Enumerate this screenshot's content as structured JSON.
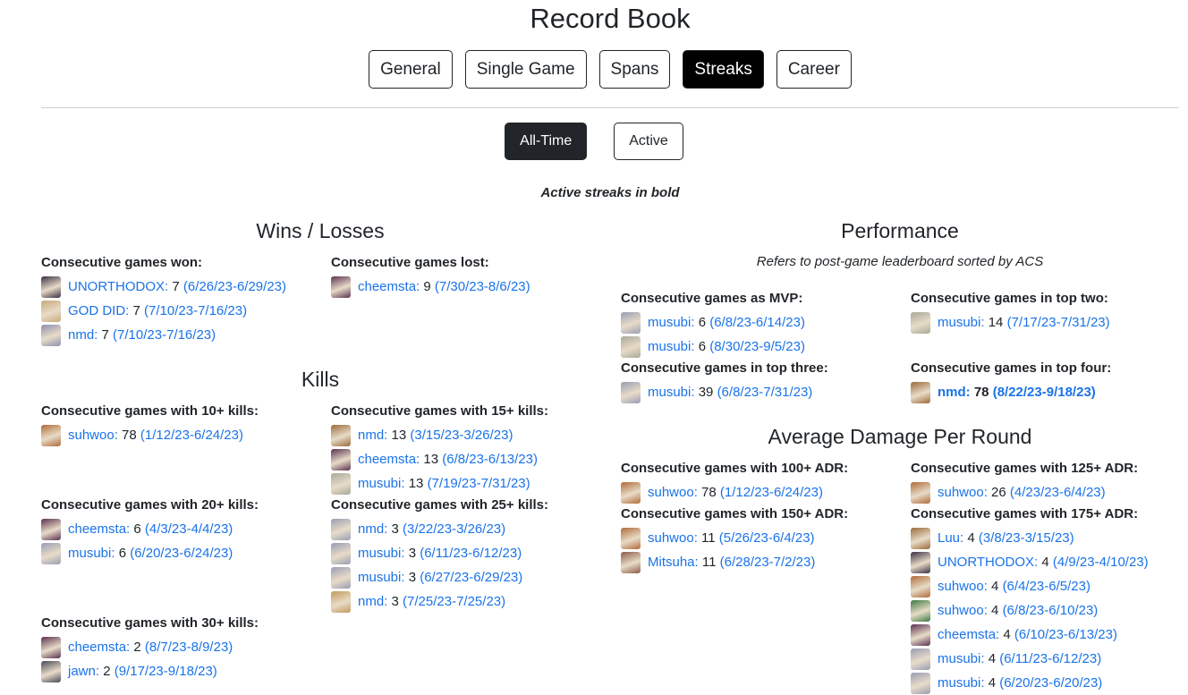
{
  "page_title": "Record Book",
  "tabs": [
    {
      "label": "General",
      "active": false
    },
    {
      "label": "Single Game",
      "active": false
    },
    {
      "label": "Spans",
      "active": false
    },
    {
      "label": "Streaks",
      "active": true
    },
    {
      "label": "Career",
      "active": false
    }
  ],
  "subtabs": [
    {
      "label": "All-Time",
      "active": true
    },
    {
      "label": "Active",
      "active": false
    }
  ],
  "note": "Active streaks in bold",
  "sections": {
    "wins": "Wins / Losses",
    "kills": "Kills",
    "performance": "Performance",
    "performance_note": "Refers to post-game leaderboard sorted by ACS",
    "adr": "Average Damage Per Round"
  },
  "blocks": {
    "games_won": {
      "title": "Consecutive games won:",
      "entries": [
        {
          "player": "UNORTHODOX:",
          "value": "7",
          "dates": "(6/26/23-6/29/23)",
          "avatar": "#3a2f45"
        },
        {
          "player": "GOD DID:",
          "value": "7",
          "dates": "(7/10/23-7/16/23)",
          "avatar": "#c9a878"
        },
        {
          "player": "nmd:",
          "value": "7",
          "dates": "(7/10/23-7/16/23)",
          "avatar": "#8c8fb0"
        }
      ]
    },
    "games_lost": {
      "title": "Consecutive games lost:",
      "entries": [
        {
          "player": "cheemsta:",
          "value": "9",
          "dates": "(7/30/23-8/6/23)",
          "avatar": "#5a3050"
        }
      ]
    },
    "kills10": {
      "title": "Consecutive games with 10+ kills:",
      "entries": [
        {
          "player": "suhwoo:",
          "value": "78",
          "dates": "(1/12/23-6/24/23)",
          "avatar": "#b06a38"
        }
      ]
    },
    "kills15": {
      "title": "Consecutive games with 15+ kills:",
      "entries": [
        {
          "player": "nmd:",
          "value": "13",
          "dates": "(3/15/23-3/26/23)",
          "avatar": "#9a6a3a"
        },
        {
          "player": "cheemsta:",
          "value": "13",
          "dates": "(6/8/23-6/13/23)",
          "avatar": "#5a3050"
        },
        {
          "player": "musubi:",
          "value": "13",
          "dates": "(7/19/23-7/31/23)",
          "avatar": "#a8a898"
        }
      ]
    },
    "kills20": {
      "title": "Consecutive games with 20+ kills:",
      "entries": [
        {
          "player": "cheemsta:",
          "value": "6",
          "dates": "(4/3/23-4/4/23)",
          "avatar": "#5a3050"
        },
        {
          "player": "musubi:",
          "value": "6",
          "dates": "(6/20/23-6/24/23)",
          "avatar": "#9a9cb4"
        }
      ]
    },
    "kills25": {
      "title": "Consecutive games with 25+ kills:",
      "entries": [
        {
          "player": "nmd:",
          "value": "3",
          "dates": "(3/22/23-3/26/23)",
          "avatar": "#9a9cb4"
        },
        {
          "player": "musubi:",
          "value": "3",
          "dates": "(6/11/23-6/12/23)",
          "avatar": "#9a9cb4"
        },
        {
          "player": "musubi:",
          "value": "3",
          "dates": "(6/27/23-6/29/23)",
          "avatar": "#9a9cb4"
        },
        {
          "player": "nmd:",
          "value": "3",
          "dates": "(7/25/23-7/25/23)",
          "avatar": "#c29a5a"
        }
      ]
    },
    "kills30": {
      "title": "Consecutive games with 30+ kills:",
      "entries": [
        {
          "player": "cheemsta:",
          "value": "2",
          "dates": "(8/7/23-8/9/23)",
          "avatar": "#5a3050"
        },
        {
          "player": "jawn:",
          "value": "2",
          "dates": "(9/17/23-9/18/23)",
          "avatar": "#4a4a58"
        }
      ]
    },
    "mvp": {
      "title": "Consecutive games as MVP:",
      "entries": [
        {
          "player": "musubi:",
          "value": "6",
          "dates": "(6/8/23-6/14/23)",
          "avatar": "#9a9cb4"
        },
        {
          "player": "musubi:",
          "value": "6",
          "dates": "(8/30/23-9/5/23)",
          "avatar": "#a8a898"
        }
      ]
    },
    "top2": {
      "title": "Consecutive games in top two:",
      "entries": [
        {
          "player": "musubi:",
          "value": "14",
          "dates": "(7/17/23-7/31/23)",
          "avatar": "#a8a898"
        }
      ]
    },
    "top3": {
      "title": "Consecutive games in top three:",
      "entries": [
        {
          "player": "musubi:",
          "value": "39",
          "dates": "(6/8/23-7/31/23)",
          "avatar": "#9a9cb4"
        }
      ]
    },
    "top4": {
      "title": "Consecutive games in top four:",
      "entries": [
        {
          "player": "nmd:",
          "value": "78",
          "dates": "(8/22/23-9/18/23)",
          "avatar": "#9a6a3a",
          "bold": true
        }
      ]
    },
    "adr100": {
      "title": "Consecutive games with 100+ ADR:",
      "entries": [
        {
          "player": "suhwoo:",
          "value": "78",
          "dates": "(1/12/23-6/24/23)",
          "avatar": "#b06a38"
        }
      ]
    },
    "adr125": {
      "title": "Consecutive games with 125+ ADR:",
      "entries": [
        {
          "player": "suhwoo:",
          "value": "26",
          "dates": "(4/23/23-6/4/23)",
          "avatar": "#b06a38"
        }
      ]
    },
    "adr150": {
      "title": "Consecutive games with 150+ ADR:",
      "entries": [
        {
          "player": "suhwoo:",
          "value": "11",
          "dates": "(5/26/23-6/4/23)",
          "avatar": "#b06a38"
        },
        {
          "player": "Mitsuha:",
          "value": "11",
          "dates": "(6/28/23-7/2/23)",
          "avatar": "#8a5a48"
        }
      ]
    },
    "adr175": {
      "title": "Consecutive games with 175+ ADR:",
      "entries": [
        {
          "player": "Luu:",
          "value": "4",
          "dates": "(3/8/23-3/15/23)",
          "avatar": "#9a6a3a"
        },
        {
          "player": "UNORTHODOX:",
          "value": "4",
          "dates": "(4/9/23-4/10/23)",
          "avatar": "#3a2f45"
        },
        {
          "player": "suhwoo:",
          "value": "4",
          "dates": "(6/4/23-6/5/23)",
          "avatar": "#b06a38"
        },
        {
          "player": "suhwoo:",
          "value": "4",
          "dates": "(6/8/23-6/10/23)",
          "avatar": "#3a7a40"
        },
        {
          "player": "cheemsta:",
          "value": "4",
          "dates": "(6/10/23-6/13/23)",
          "avatar": "#5a3050"
        },
        {
          "player": "musubi:",
          "value": "4",
          "dates": "(6/11/23-6/12/23)",
          "avatar": "#9a9cb4"
        },
        {
          "player": "musubi:",
          "value": "4",
          "dates": "(6/20/23-6/20/23)",
          "avatar": "#9a9cb4"
        }
      ]
    }
  }
}
